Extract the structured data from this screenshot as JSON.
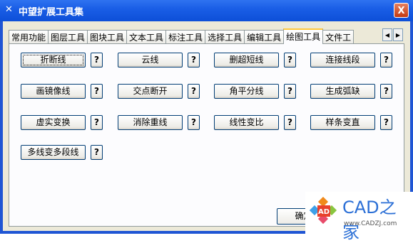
{
  "window": {
    "title": "中望扩展工具集",
    "close_label": "X"
  },
  "tabs": [
    {
      "label": "常用功能",
      "active": false
    },
    {
      "label": "图层工具",
      "active": false
    },
    {
      "label": "图块工具",
      "active": false
    },
    {
      "label": "文本工具",
      "active": false
    },
    {
      "label": "标注工具",
      "active": false
    },
    {
      "label": "选择工具",
      "active": false
    },
    {
      "label": "编辑工具",
      "active": false
    },
    {
      "label": "绘图工具",
      "active": true
    },
    {
      "label": "文件工",
      "active": false
    }
  ],
  "tools": [
    {
      "label": "折断线",
      "help": "?"
    },
    {
      "label": "云线",
      "help": "?"
    },
    {
      "label": "删超短线",
      "help": "?"
    },
    {
      "label": "连接线段",
      "help": "?"
    },
    {
      "label": "画镜像线",
      "help": "?"
    },
    {
      "label": "交点断开",
      "help": "?"
    },
    {
      "label": "角平分线",
      "help": "?"
    },
    {
      "label": "生成弧缺",
      "help": "?"
    },
    {
      "label": "虚实变换",
      "help": "?"
    },
    {
      "label": "消除重线",
      "help": "?"
    },
    {
      "label": "线性变比",
      "help": "?"
    },
    {
      "label": "样条变直",
      "help": "?"
    },
    {
      "label": "多线变多段线",
      "help": "?"
    }
  ],
  "ok_label": "确定",
  "watermark": {
    "text": "CAD之家",
    "url": "www.CADZJ.com",
    "logo_text": "AD"
  }
}
